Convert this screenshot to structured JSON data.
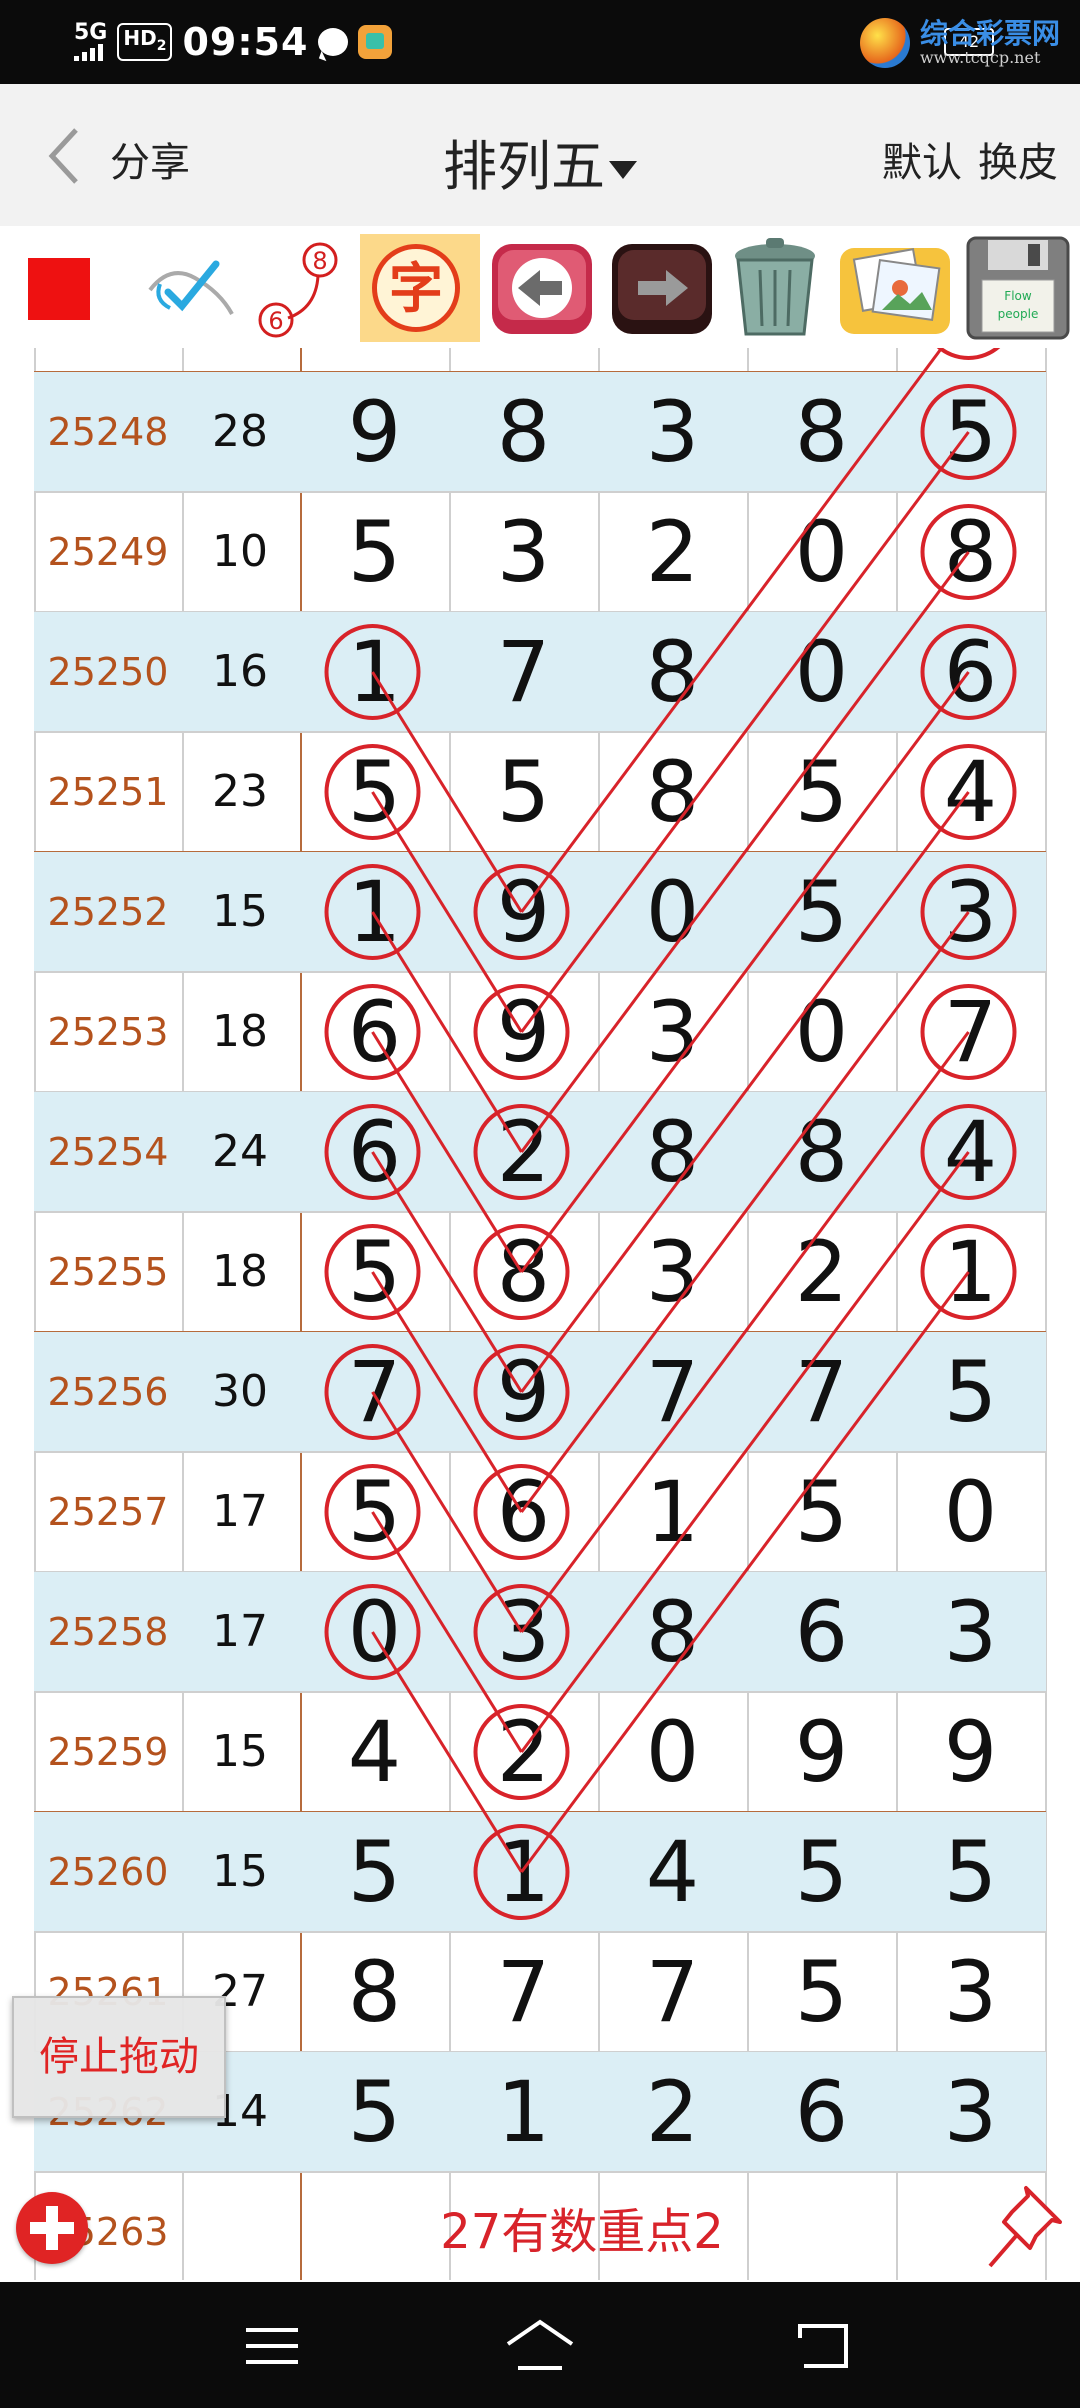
{
  "status_bar": {
    "network": "5G",
    "hd": "HD",
    "hd_sub": "2",
    "time": "09:54",
    "battery": "42",
    "logo_title": "综合彩票网",
    "logo_url": "www.tcqcp.net"
  },
  "app_bar": {
    "share_label": "分享",
    "title": "排列五",
    "default_label": "默认",
    "skin_label": "换皮"
  },
  "toolbar": {
    "zi_label": "字",
    "eraser_top": "8",
    "eraser_bottom": "6",
    "save_text1": "Flow",
    "save_text2": "people"
  },
  "colors": {
    "period_text": "#b4521d",
    "shade_row": "#dbeef5",
    "accent_red": "#d8232a"
  },
  "table": {
    "rows": [
      {
        "period": "",
        "sum": "",
        "digits": [
          "",
          "",
          "",
          "",
          ""
        ],
        "shaded": false
      },
      {
        "period": "25248",
        "sum": "28",
        "digits": [
          "9",
          "8",
          "3",
          "8",
          "5"
        ],
        "shaded": true
      },
      {
        "period": "25249",
        "sum": "10",
        "digits": [
          "5",
          "3",
          "2",
          "0",
          "8"
        ],
        "shaded": false
      },
      {
        "period": "25250",
        "sum": "16",
        "digits": [
          "1",
          "7",
          "8",
          "0",
          "6"
        ],
        "shaded": true
      },
      {
        "period": "25251",
        "sum": "23",
        "digits": [
          "5",
          "5",
          "8",
          "5",
          "4"
        ],
        "shaded": false
      },
      {
        "period": "25252",
        "sum": "15",
        "digits": [
          "1",
          "9",
          "0",
          "5",
          "3"
        ],
        "shaded": true
      },
      {
        "period": "25253",
        "sum": "18",
        "digits": [
          "6",
          "9",
          "3",
          "0",
          "7"
        ],
        "shaded": false
      },
      {
        "period": "25254",
        "sum": "24",
        "digits": [
          "6",
          "2",
          "8",
          "8",
          "4"
        ],
        "shaded": true
      },
      {
        "period": "25255",
        "sum": "18",
        "digits": [
          "5",
          "8",
          "3",
          "2",
          "1"
        ],
        "shaded": false
      },
      {
        "period": "25256",
        "sum": "30",
        "digits": [
          "7",
          "9",
          "7",
          "7",
          "5"
        ],
        "shaded": true
      },
      {
        "period": "25257",
        "sum": "17",
        "digits": [
          "5",
          "6",
          "1",
          "5",
          "0"
        ],
        "shaded": false
      },
      {
        "period": "25258",
        "sum": "17",
        "digits": [
          "0",
          "3",
          "8",
          "6",
          "3"
        ],
        "shaded": true
      },
      {
        "period": "25259",
        "sum": "15",
        "digits": [
          "4",
          "2",
          "0",
          "9",
          "9"
        ],
        "shaded": false
      },
      {
        "period": "25260",
        "sum": "15",
        "digits": [
          "5",
          "1",
          "4",
          "5",
          "5"
        ],
        "shaded": true
      },
      {
        "period": "25261",
        "sum": "27",
        "digits": [
          "8",
          "7",
          "7",
          "5",
          "3"
        ],
        "shaded": false
      },
      {
        "period": "25262",
        "sum": "14",
        "digits": [
          "5",
          "1",
          "2",
          "6",
          "3"
        ],
        "shaded": true
      },
      {
        "period": "25263",
        "sum": "",
        "digits": [
          "",
          "",
          "",
          "",
          ""
        ],
        "shaded": false,
        "note": "27有数重点2"
      }
    ]
  },
  "floating": {
    "stop_drag_label": "停止拖动"
  }
}
